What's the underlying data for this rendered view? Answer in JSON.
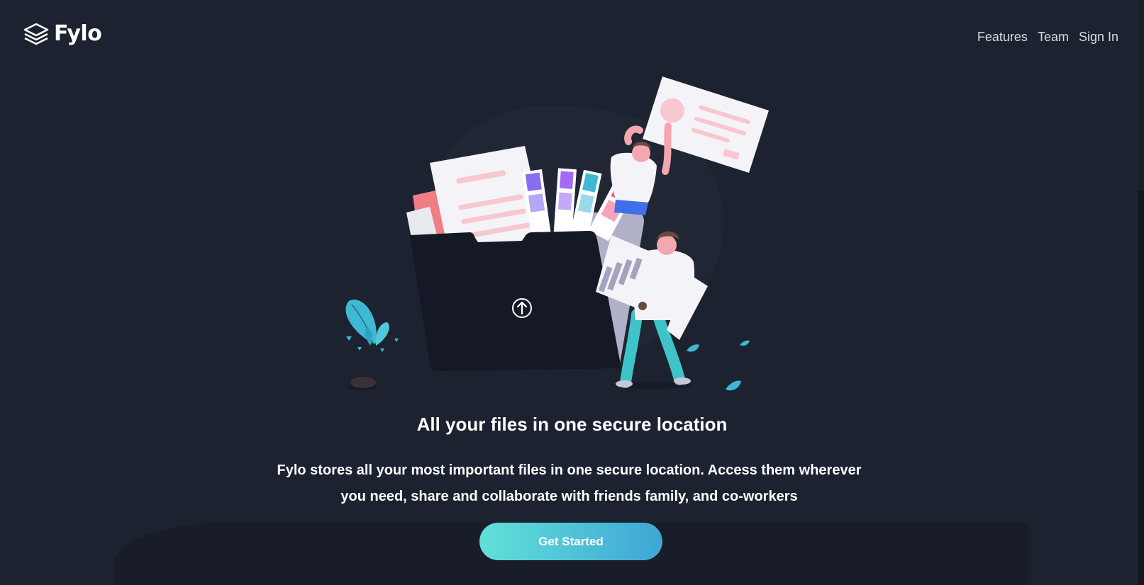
{
  "brand": {
    "name": "Fylo",
    "logo_icon": "stacked-layers-icon"
  },
  "nav": {
    "items": [
      {
        "label": "Features"
      },
      {
        "label": "Team"
      },
      {
        "label": "Sign In"
      }
    ]
  },
  "hero": {
    "title": "All your files in one secure location",
    "text_line1": "Fylo stores all your most important files in one secure location. Access them wherever",
    "text_line2": "you need, share and collaborate with friends family, and co-workers",
    "cta_label": "Get Started",
    "illustration_icon": "upload-arrow-icon"
  },
  "colors": {
    "background": "#1c2230",
    "cta_gradient_start": "#62e0d9",
    "cta_gradient_end": "#3fa6d6",
    "text": "#ffffff",
    "nav_text": "#d8dbe2"
  }
}
